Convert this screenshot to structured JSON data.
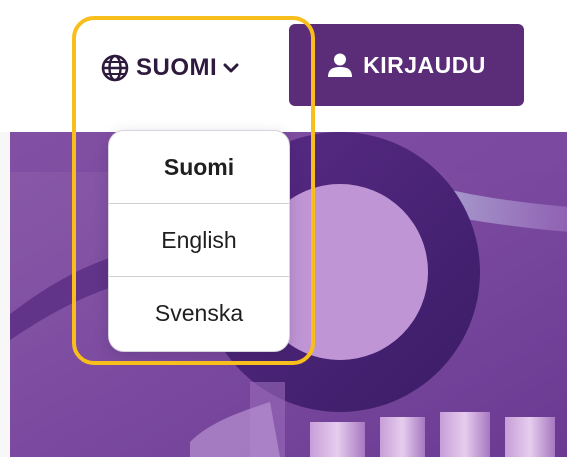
{
  "header": {
    "language_selector": {
      "current_label": "SUOMI",
      "icon": "globe-icon",
      "chevron_icon": "chevron-down-icon"
    },
    "login_button": {
      "label": "KIRJAUDU",
      "icon": "user-icon"
    }
  },
  "language_menu": {
    "options": [
      {
        "label": "Suomi",
        "selected": true
      },
      {
        "label": "English",
        "selected": false
      },
      {
        "label": "Svenska",
        "selected": false
      }
    ]
  },
  "colors": {
    "brand_purple": "#5b2d78",
    "highlight_yellow": "#f7be1c",
    "text_dark": "#2e1a3c"
  }
}
